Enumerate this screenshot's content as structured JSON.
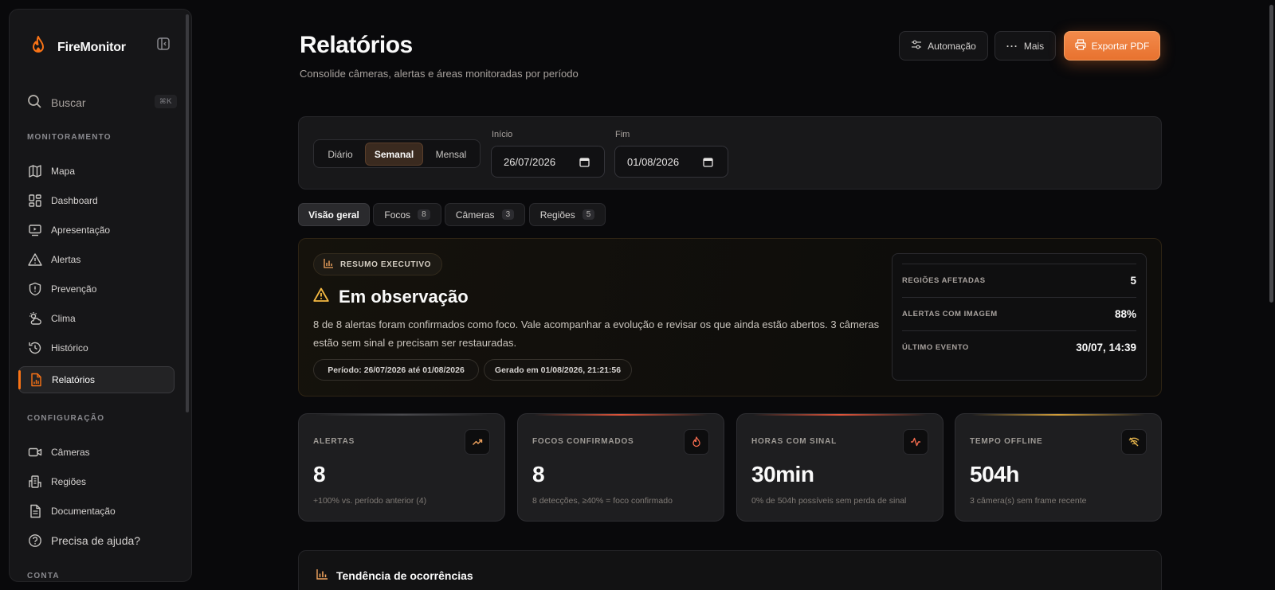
{
  "app": {
    "name": "FireMonitor"
  },
  "search": {
    "label": "Buscar",
    "shortcut": "⌘K"
  },
  "sidebar": {
    "sections": [
      {
        "title": "MONITORAMENTO",
        "items": [
          {
            "label": "Mapa",
            "icon": "map-icon"
          },
          {
            "label": "Dashboard",
            "icon": "dashboard-icon"
          },
          {
            "label": "Apresentação",
            "icon": "presentation-icon"
          },
          {
            "label": "Alertas",
            "icon": "alert-icon"
          },
          {
            "label": "Prevenção",
            "icon": "shield-icon"
          },
          {
            "label": "Clima",
            "icon": "weather-icon"
          },
          {
            "label": "Histórico",
            "icon": "history-icon"
          },
          {
            "label": "Relatórios",
            "icon": "report-icon",
            "active": true
          }
        ]
      },
      {
        "title": "CONFIGURAÇÃO",
        "items": [
          {
            "label": "Câmeras",
            "icon": "camera-icon"
          },
          {
            "label": "Regiões",
            "icon": "building-icon"
          },
          {
            "label": "Documentação",
            "icon": "document-icon"
          },
          {
            "label": "Precisa de ajuda?",
            "icon": "help-icon"
          }
        ]
      },
      {
        "title": "CONTA",
        "items": []
      }
    ]
  },
  "header": {
    "title": "Relatórios",
    "subtitle": "Consolide câmeras, alertas e áreas monitoradas por período",
    "buttons": {
      "automation": "Automação",
      "more": "Mais",
      "export": "Exportar PDF"
    }
  },
  "filters": {
    "periods": [
      "Diário",
      "Semanal",
      "Mensal"
    ],
    "selected_period": "Semanal",
    "start": {
      "label": "Início",
      "value": "26/07/2026"
    },
    "end": {
      "label": "Fim",
      "value": "01/08/2026"
    }
  },
  "tabs": [
    {
      "label": "Visão geral",
      "count": null,
      "active": true
    },
    {
      "label": "Focos",
      "count": "8"
    },
    {
      "label": "Câmeras",
      "count": "3"
    },
    {
      "label": "Regiões",
      "count": "5"
    }
  ],
  "summary": {
    "chip": "RESUMO EXECUTIVO",
    "status": "Em observação",
    "description": "8 de 8 alertas foram confirmados como foco. Vale acompanhar a evolução e revisar os que ainda estão abertos. 3 câmeras estão sem sinal e precisam ser restauradas.",
    "period": "Período: 26/07/2026 até 01/08/2026",
    "generated": "Gerado em 01/08/2026, 21:21:56",
    "stats": [
      {
        "label": "REGIÕES AFETADAS",
        "value": "5"
      },
      {
        "label": "ALERTAS COM IMAGEM",
        "value": "88%"
      },
      {
        "label": "ÚLTIMO EVENTO",
        "value": "30/07, 14:39"
      }
    ]
  },
  "kpis": [
    {
      "label": "ALERTAS",
      "value": "8",
      "note": "+100% vs. período anterior (4)",
      "icon": "trend-up-icon",
      "accent": "#4a4a4e"
    },
    {
      "label": "FOCOS CONFIRMADOS",
      "value": "8",
      "note": "8 detecções, ≥40% = foco confirmado",
      "icon": "flame-icon",
      "accent": "#e2553a"
    },
    {
      "label": "HORAS COM SINAL",
      "value": "30min",
      "note": "0% de 504h possíveis sem perda de sinal",
      "icon": "activity-icon",
      "accent": "#e2553a"
    },
    {
      "label": "TEMPO OFFLINE",
      "value": "504h",
      "note": "3 câmera(s) sem frame recente",
      "icon": "signal-off-icon",
      "accent": "#d4a03a"
    }
  ],
  "trend": {
    "title": "Tendência de ocorrências"
  },
  "colors": {
    "accent": "#f97316",
    "background": "#09090b",
    "card": "#1e1e20"
  }
}
